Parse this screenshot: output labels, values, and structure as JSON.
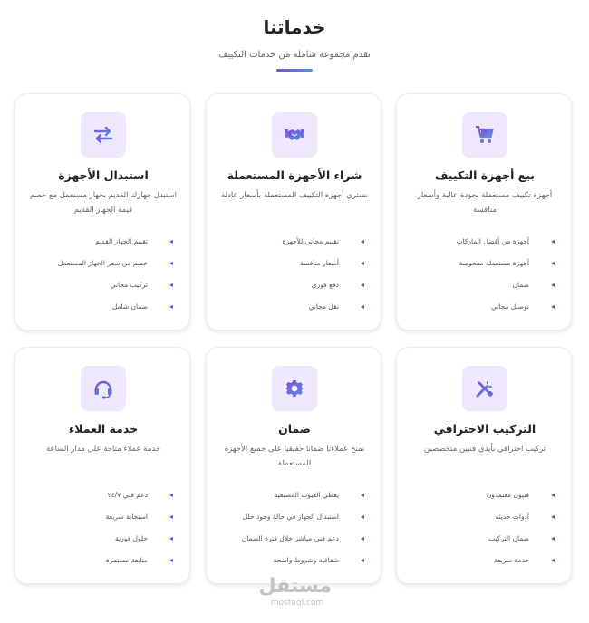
{
  "header": {
    "title": "خدماتنا",
    "subtitle": "نقدم مجموعة شاملة من خدمات التكييف"
  },
  "colors": {
    "accent": "#5b4fd6",
    "icon_bg": "#efe7fb",
    "icon_gradient_start": "#7b4fd6",
    "icon_gradient_end": "#5a8de0"
  },
  "cards": [
    {
      "icon": "shopping-cart-icon",
      "title": "بيع أجهزة التكييف",
      "description": "أجهزة تكييف مستعملة بجودة عالية وأسعار منافسة",
      "features": [
        "أجهزة من أفضل الماركات",
        "أجهزة مستعملة مفحوصة",
        "ضمان",
        "توصيل مجاني"
      ]
    },
    {
      "icon": "handshake-icon",
      "title": "شراء الأجهزة المستعملة",
      "description": "نشتري أجهزة التكييف المستعملة بأسعار عادلة",
      "features": [
        "تقييم مجاني للأجهزة",
        "أسعار منافسة",
        "دفع فوري",
        "نقل مجاني"
      ]
    },
    {
      "icon": "exchange-arrows-icon",
      "title": "استبدال الأجهزة",
      "description": "استبدل جهازك القديم بجهاز مستعمل مع خصم قيمة الجهاز القديم",
      "features": [
        "تقييم الجهاز القديم",
        "خصم من سعر الجهاز المستعمل",
        "تركيب مجاني",
        "ضمان شامل"
      ]
    },
    {
      "icon": "tools-icon",
      "title": "التركيب الاحترافي",
      "description": "تركيب احترافي بأيدي فنيين متخصصين",
      "features": [
        "فنيون معتمدون",
        "أدوات حديثة",
        "ضمان التركيب",
        "خدمة سريعة"
      ]
    },
    {
      "icon": "gear-icon",
      "title": "ضمان",
      "description": "نمنح عملاءنا ضمانا حقيقيا على جميع الأجهزة المستعملة",
      "features": [
        "يغطي العيوب المصنعية",
        "استبدال الجهاز في حالة وجود خلل",
        "دعم فني مباشر خلال فترة الضمان",
        "شفافية وشروط واضحة"
      ]
    },
    {
      "icon": "headset-icon",
      "title": "خدمة العملاء",
      "description": "خدمة عملاء متاحة على مدار الساعة",
      "features": [
        "دعم فني ٢٤/٧",
        "استجابة سريعة",
        "حلول فورية",
        "متابعة مستمرة"
      ]
    }
  ],
  "watermark": {
    "logo": "مستقل",
    "url": "mostaql.com"
  }
}
